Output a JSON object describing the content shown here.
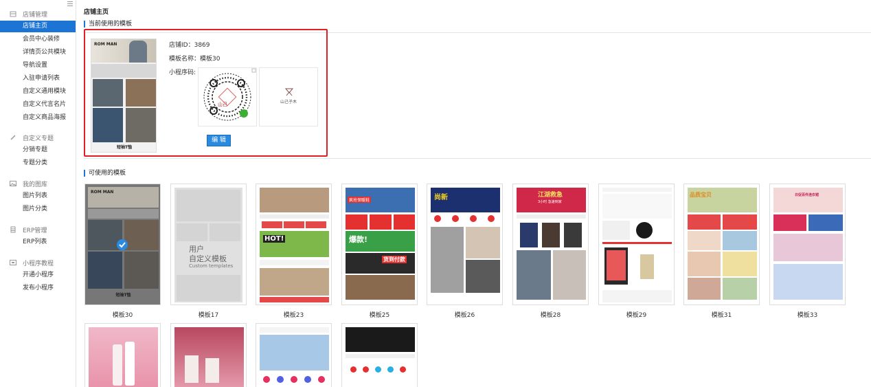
{
  "sidebar": {
    "groups": [
      {
        "title": "店铺管理",
        "icon": "store-icon",
        "items": [
          "店铺主页",
          "会员中心装修",
          "详情页公共模块",
          "导航设置",
          "入驻申请列表",
          "自定义通用模块",
          "自定义代言名片",
          "自定义商品海报"
        ]
      },
      {
        "title": "自定义专题",
        "icon": "pencil-icon",
        "items": [
          "分销专题",
          "专题分类"
        ]
      },
      {
        "title": "我的图库",
        "icon": "image-icon",
        "items": [
          "图片列表",
          "图片分类"
        ]
      },
      {
        "title": "ERP管理",
        "icon": "database-icon",
        "items": [
          "ERP列表"
        ]
      },
      {
        "title": "小程序教程",
        "icon": "monitor-icon",
        "items": [
          "开通小程序",
          "发布小程序"
        ]
      }
    ],
    "active_item": "店铺主页"
  },
  "main": {
    "page_title": "店铺主页",
    "current_section_title": "当前使用的模板",
    "store_id_label": "店铺ID：",
    "store_id": "3869",
    "template_name_label": "模板名称：",
    "template_name": "模板30",
    "mini_program_label": "小程序码:",
    "logo_text": "山己子木",
    "qr_logo_text": "山己",
    "edit_button": "编 辑",
    "current_thumb_caption": "短袖T恤",
    "available_section_title": "可使用的模板",
    "custom_template": {
      "line1": "用户",
      "line2": "自定义模板",
      "line3": "Custom templates"
    },
    "templates": [
      "模板30",
      "模板17",
      "模板23",
      "模板25",
      "模板26",
      "模板28",
      "模板29",
      "模板31",
      "模板33"
    ],
    "thumb_texts": {
      "t30_brand": "ROM MAN",
      "t23_banner": "HOT!",
      "t25_title": "疯抢保暖鞋",
      "t25_sale": "爆款!",
      "t25_cod": "货到付款",
      "t26_brand": "尚新",
      "t28_title": "江湖救急",
      "t28_sub": "3小时 急速到家",
      "t31_title": "品质宝贝",
      "t33_title": "日促百件连衣裙"
    }
  },
  "colors": {
    "accent": "#1c74d4",
    "highlight_border": "#e02020",
    "button": "#2a8ae0"
  }
}
